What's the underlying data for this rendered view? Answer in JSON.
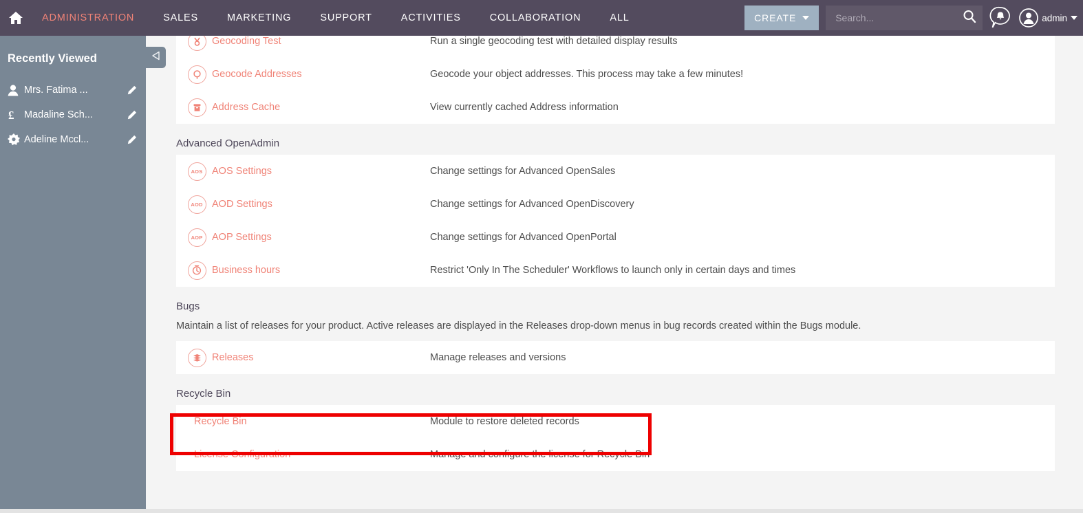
{
  "topbar": {
    "home_icon": "home-icon",
    "nav": [
      {
        "label": "ADMINISTRATION",
        "active": true
      },
      {
        "label": "SALES",
        "active": false
      },
      {
        "label": "MARKETING",
        "active": false
      },
      {
        "label": "SUPPORT",
        "active": false
      },
      {
        "label": "ACTIVITIES",
        "active": false
      },
      {
        "label": "COLLABORATION",
        "active": false
      },
      {
        "label": "ALL",
        "active": false
      }
    ],
    "create_label": "CREATE",
    "search_placeholder": "Search...",
    "search_value": "",
    "search_icon": "search-icon",
    "notification_icon": "notification-bell-icon",
    "user_icon": "user-avatar-icon",
    "user_label": "admin",
    "accent_color": "#f08377",
    "bar_color": "#534b5e",
    "create_button_color": "#9fb1c1"
  },
  "sidebar": {
    "title": "Recently Viewed",
    "collapse_icon": "collapse-left-icon",
    "items": [
      {
        "label": "Mrs. Fatima ...",
        "icon": "contact-person-icon",
        "edit_icon": "pencil-icon"
      },
      {
        "label": "Madaline Sch...",
        "icon": "opportunity-pound-icon",
        "edit_icon": "pencil-icon"
      },
      {
        "label": "Adeline Mccl...",
        "icon": "lead-star-icon",
        "edit_icon": "pencil-icon"
      }
    ],
    "background_color": "#798795"
  },
  "main": {
    "groups": [
      {
        "id": "maps-partial",
        "heading": null,
        "subtitle": null,
        "rows": [
          {
            "title": "Geocoding Test",
            "desc": "Run a single geocoding test with detailed display results",
            "icon": "geocoding-test-icon",
            "clipped": true
          },
          {
            "title": "Geocode Addresses",
            "desc": "Geocode your object addresses. This process may take a few minutes!",
            "icon": "geocode-addresses-icon"
          },
          {
            "title": "Address Cache",
            "desc": "View currently cached Address information",
            "icon": "address-cache-icon"
          }
        ]
      },
      {
        "id": "advanced-openadmin",
        "heading": "Advanced OpenAdmin",
        "subtitle": null,
        "rows": [
          {
            "title": "AOS Settings",
            "desc": "Change settings for Advanced OpenSales",
            "icon": "aos-settings-icon",
            "icon_text": "AOS"
          },
          {
            "title": "AOD Settings",
            "desc": "Change settings for Advanced OpenDiscovery",
            "icon": "aod-settings-icon",
            "icon_text": "AOD"
          },
          {
            "title": "AOP Settings",
            "desc": "Change settings for Advanced OpenPortal",
            "icon": "aop-settings-icon",
            "icon_text": "AOP"
          },
          {
            "title": "Business hours",
            "desc": "Restrict 'Only In The Scheduler' Workflows to launch only in certain days and times",
            "icon": "business-hours-clock-icon"
          }
        ]
      },
      {
        "id": "bugs",
        "heading": "Bugs",
        "subtitle": "Maintain a list of releases for your product. Active releases are displayed in the Releases drop-down menus in bug records created within the Bugs module.",
        "rows": [
          {
            "title": "Releases",
            "desc": "Manage releases and versions",
            "icon": "releases-layers-icon"
          }
        ]
      },
      {
        "id": "recycle-bin",
        "heading": "Recycle Bin",
        "subtitle": null,
        "rows": [
          {
            "title": "Recycle Bin",
            "desc": "Module to restore deleted records",
            "icon": null,
            "highlighted": true
          },
          {
            "title": "License Configuration",
            "desc": "Manage and configure the license for Recycle Bin",
            "icon": null
          }
        ]
      }
    ],
    "highlight_color": "#ee0000",
    "link_color": "#f08377",
    "description_color": "#4d4d4d",
    "panel_color": "#ffffff",
    "background_color": "#f4f4f4"
  }
}
